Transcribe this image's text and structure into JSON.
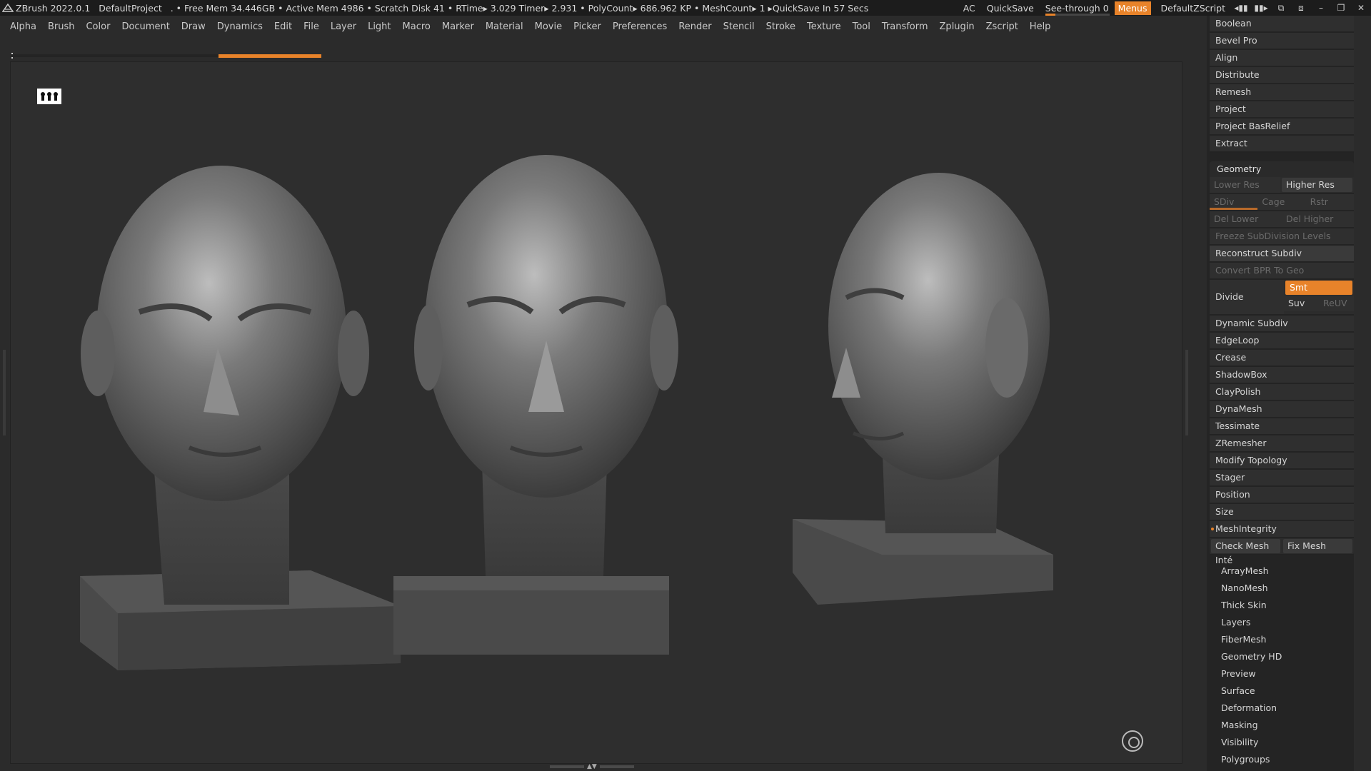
{
  "titlebar": {
    "app": "ZBrush 2022.0.1",
    "project": "DefaultProject",
    "status": ". • Free Mem 34.446GB • Active Mem 4986 • Scratch Disk 41 •  RTime▸ 3.029 Timer▸ 2.931 • PolyCount▸ 686.962 KP  • MeshCount▸ 1  ▸QuickSave In 57 Secs",
    "ac": "AC",
    "quicksave": "QuickSave",
    "see_through": "See-through  0",
    "see_through_value": 0,
    "menus": "Menus",
    "default_zscript": "DefaultZScript"
  },
  "menubar": [
    "Alpha",
    "Brush",
    "Color",
    "Document",
    "Draw",
    "Dynamics",
    "Edit",
    "File",
    "Layer",
    "Light",
    "Macro",
    "Marker",
    "Material",
    "Movie",
    "Picker",
    "Preferences",
    "Render",
    "Stencil",
    "Stroke",
    "Texture",
    "Tool",
    "Transform",
    "Zplugin",
    "Zscript",
    "Help"
  ],
  "panel": {
    "top_items": [
      "Boolean",
      "Bevel Pro",
      "Align",
      "Distribute",
      "Remesh",
      "Project",
      "Project BasRelief",
      "Extract"
    ],
    "geometry": {
      "title": "Geometry",
      "lower_res": "Lower Res",
      "higher_res": "Higher Res",
      "sdiv": "SDiv",
      "cage": "Cage",
      "rstr": "Rstr",
      "del_lower": "Del Lower",
      "del_higher": "Del Higher",
      "freeze": "Freeze SubDivision Levels",
      "reconstruct": "Reconstruct Subdiv",
      "convert_bpr": "Convert BPR To Geo",
      "divide": "Divide",
      "smt": "Smt",
      "suv": "Suv",
      "reuv": "ReUV",
      "items": [
        "Dynamic Subdiv",
        "EdgeLoop",
        "Crease",
        "ShadowBox",
        "ClayPolish",
        "DynaMesh",
        "Tessimate",
        "ZRemesher",
        "Modify Topology",
        "Stager",
        "Position",
        "Size"
      ],
      "mesh_integrity": "MeshIntegrity",
      "check_mesh": "Check Mesh Inté",
      "fix_mesh": "Fix Mesh"
    },
    "bottom_items": [
      "ArrayMesh",
      "NanoMesh",
      "Thick Skin",
      "Layers",
      "FiberMesh",
      "Geometry HD",
      "Preview",
      "Surface",
      "Deformation",
      "Masking",
      "Visibility",
      "Polygroups"
    ]
  },
  "colors": {
    "accent": "#e8832a",
    "bg": "#2b2b2b",
    "panel": "#242424"
  }
}
